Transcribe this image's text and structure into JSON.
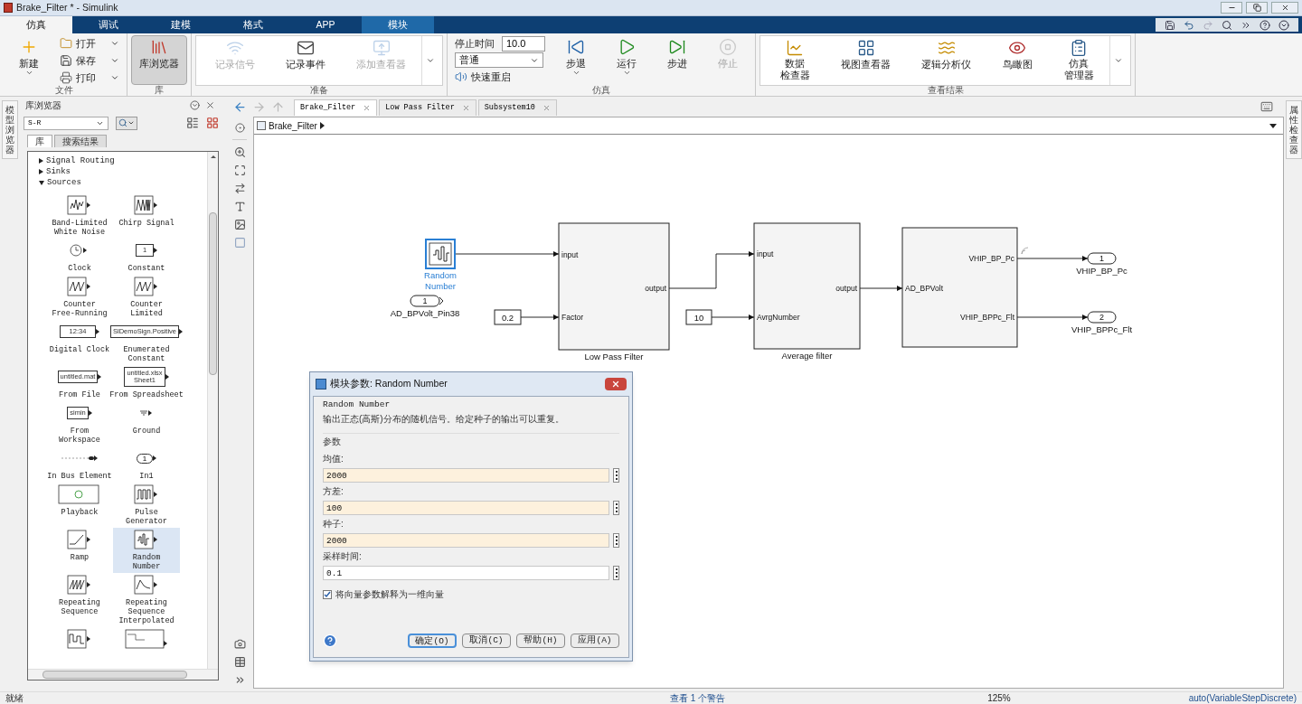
{
  "window": {
    "title": "Brake_Filter * - Simulink"
  },
  "ribbon_tabs": [
    {
      "label": "仿真",
      "selected": true,
      "contextual": false
    },
    {
      "label": "调试",
      "selected": false,
      "contextual": false
    },
    {
      "label": "建模",
      "selected": false,
      "contextual": false
    },
    {
      "label": "格式",
      "selected": false,
      "contextual": false
    },
    {
      "label": "APP",
      "selected": false,
      "contextual": false
    },
    {
      "label": "模块",
      "selected": false,
      "contextual": true
    }
  ],
  "toolstrip": {
    "groups": [
      {
        "label": "文件",
        "gallery": false,
        "items": [
          {
            "kind": "large",
            "label": "新建",
            "dropdown": true,
            "disabled": false,
            "pressed": false
          },
          {
            "kind": "small",
            "label": "打开",
            "dropdown": true,
            "disabled": false
          },
          {
            "kind": "small",
            "label": "保存",
            "dropdown": true,
            "disabled": false
          },
          {
            "kind": "small",
            "label": "打印",
            "dropdown": true,
            "disabled": false
          }
        ]
      },
      {
        "label": "库",
        "gallery": false,
        "items": [
          {
            "kind": "large",
            "label": "库浏览器",
            "dropdown": false,
            "disabled": false,
            "pressed": true
          }
        ]
      },
      {
        "label": "准备",
        "gallery": true,
        "items": [
          {
            "kind": "large",
            "label": "记录信号",
            "dropdown": false,
            "disabled": true,
            "pressed": false
          },
          {
            "kind": "large",
            "label": "记录事件",
            "dropdown": false,
            "disabled": false,
            "pressed": false
          },
          {
            "kind": "large",
            "label": "添加查看器",
            "dropdown": false,
            "disabled": true,
            "pressed": false
          }
        ]
      },
      {
        "label": "仿真",
        "gallery": false,
        "items": [
          {
            "kind": "field",
            "label": "停止时间",
            "value": "10.0"
          },
          {
            "kind": "select",
            "value": "普通"
          },
          {
            "kind": "small",
            "label": "快速重启",
            "dropdown": false,
            "disabled": false
          },
          {
            "kind": "large",
            "label": "步退",
            "dropdown": true,
            "disabled": false,
            "pressed": false
          },
          {
            "kind": "large",
            "label": "运行",
            "dropdown": true,
            "disabled": false,
            "pressed": false
          },
          {
            "kind": "large",
            "label": "步进",
            "dropdown": false,
            "disabled": false,
            "pressed": false
          },
          {
            "kind": "large",
            "label": "停止",
            "dropdown": false,
            "disabled": true,
            "pressed": false
          }
        ]
      },
      {
        "label": "查看结果",
        "gallery": true,
        "items": [
          {
            "kind": "large",
            "label_lines": [
              "数据",
              "检查器"
            ],
            "dropdown": false,
            "disabled": false,
            "pressed": false
          },
          {
            "kind": "large",
            "label": "视图查看器",
            "dropdown": false,
            "disabled": false,
            "pressed": false
          },
          {
            "kind": "large",
            "label": "逻辑分析仪",
            "dropdown": false,
            "disabled": false,
            "pressed": false
          },
          {
            "kind": "large",
            "label": "鸟瞰图",
            "dropdown": false,
            "disabled": false,
            "pressed": false
          },
          {
            "kind": "large",
            "label_lines": [
              "仿真",
              "管理器"
            ],
            "dropdown": false,
            "disabled": false,
            "pressed": false
          }
        ]
      }
    ]
  },
  "left_strip": {
    "label": "模型浏览器"
  },
  "right_strip": {
    "label": "属性检查器"
  },
  "library_browser": {
    "title": "库浏览器",
    "search": "S-R",
    "tabs": [
      {
        "label": "库",
        "selected": true
      },
      {
        "label": "搜索结果",
        "selected": false
      }
    ],
    "tree": [
      {
        "label": "Signal Routing",
        "expanded": false
      },
      {
        "label": "Sinks",
        "expanded": false
      },
      {
        "label": "Sources",
        "expanded": true
      }
    ],
    "blocks": [
      {
        "kind": "noise",
        "label": "Band-Limited\nWhite Noise",
        "selected": false
      },
      {
        "kind": "chirp",
        "label": "Chirp Signal",
        "selected": false
      },
      {
        "kind": "clock",
        "label": "Clock",
        "selected": false
      },
      {
        "kind": "text",
        "icon_text": "1",
        "label": "Constant",
        "selected": false
      },
      {
        "kind": "counter",
        "label": "Counter\nFree-Running",
        "selected": false
      },
      {
        "kind": "counter",
        "label": "Counter\nLimited",
        "selected": false
      },
      {
        "kind": "wide_text",
        "icon_text": "12:34",
        "label": "Digital Clock",
        "selected": false
      },
      {
        "kind": "wide_text",
        "icon_text": "SlDemoSign.Positive",
        "label": "Enumerated\nConstant",
        "selected": false
      },
      {
        "kind": "text",
        "icon_text": "untitled.mat",
        "label": "From File",
        "selected": false
      },
      {
        "kind": "text",
        "icon_text": "untitled.xlsx\nSheet1",
        "label": "From Spreadsheet",
        "selected": false
      },
      {
        "kind": "text",
        "icon_text": "simin",
        "label": "From\nWorkspace",
        "selected": false
      },
      {
        "kind": "ground",
        "label": "Ground",
        "selected": false
      },
      {
        "kind": "bus",
        "label": "In Bus Element",
        "selected": false
      },
      {
        "kind": "inport",
        "icon_text": "1",
        "label": "In1",
        "selected": false
      },
      {
        "kind": "playback",
        "label": "Playback",
        "selected": false
      },
      {
        "kind": "pulse",
        "label": "Pulse\nGenerator",
        "selected": false
      },
      {
        "kind": "ramp",
        "label": "Ramp",
        "selected": false
      },
      {
        "kind": "random",
        "label": "Random\nNumber",
        "selected": true
      },
      {
        "kind": "sawtooth",
        "label": "Repeating\nSequence",
        "selected": false
      },
      {
        "kind": "interp",
        "label": "Repeating\nSequence\nInterpolated",
        "selected": false
      },
      {
        "kind": "stair",
        "selected": false
      },
      {
        "kind": "builder",
        "selected": false
      }
    ]
  },
  "editor": {
    "tabs": [
      {
        "label": "Brake_Filter",
        "selected": true
      },
      {
        "label": "Low Pass Filter",
        "selected": false
      },
      {
        "label": "Subsystem10",
        "selected": false
      }
    ],
    "breadcrumb": "Brake_Filter",
    "diagram": {
      "blocks": [
        {
          "kind": "random",
          "label": "Random\nNumber",
          "selected": true
        },
        {
          "kind": "inport",
          "value": "1",
          "label": "AD_BPVolt_Pin38",
          "selected": false
        },
        {
          "kind": "constant",
          "value": "0.2",
          "selected": false
        },
        {
          "kind": "subsystem",
          "label": "Low Pass Filter",
          "inputs": [
            "input",
            "Factor"
          ],
          "outputs": [
            "output"
          ],
          "selected": false
        },
        {
          "kind": "constant",
          "value": "10",
          "selected": false
        },
        {
          "kind": "subsystem",
          "label": "Average filter",
          "inputs": [
            "input",
            "AvrgNumber"
          ],
          "outputs": [
            "output"
          ],
          "selected": false
        },
        {
          "kind": "subsystem",
          "inputs": [
            "AD_BPVolt"
          ],
          "outputs": [
            "VHIP_BP_Pc",
            "VHIP_BPPc_Flt"
          ],
          "selected": false
        },
        {
          "kind": "outport",
          "value": "1",
          "label": "VHIP_BP_Pc",
          "selected": false
        },
        {
          "kind": "outport",
          "value": "2",
          "label": "VHIP_BPPc_Flt",
          "selected": false
        }
      ]
    }
  },
  "dialog": {
    "title": "模块参数: Random Number",
    "block_name": "Random Number",
    "description": "输出正态(高斯)分布的随机信号。给定种子的输出可以重复。",
    "section": "参数",
    "params": [
      {
        "label": "均值:",
        "value": "2000",
        "highlighted": true
      },
      {
        "label": "方差:",
        "value": "100",
        "highlighted": true
      },
      {
        "label": "种子:",
        "value": "2000",
        "highlighted": true
      },
      {
        "label": "采样时间:",
        "value": "0.1",
        "highlighted": false
      }
    ],
    "checkbox": {
      "label": "将向量参数解释为一维向量",
      "checked": true
    },
    "buttons": [
      {
        "label": "确定(O)",
        "default": true
      },
      {
        "label": "取消(C)",
        "default": false
      },
      {
        "label": "帮助(H)",
        "default": false
      },
      {
        "label": "应用(A)",
        "default": false
      }
    ]
  },
  "status_bar": {
    "state": "就绪",
    "warnings": "查看 1 个警告",
    "zoom": "125%",
    "solver": "auto(VariableStepDiscrete)"
  }
}
